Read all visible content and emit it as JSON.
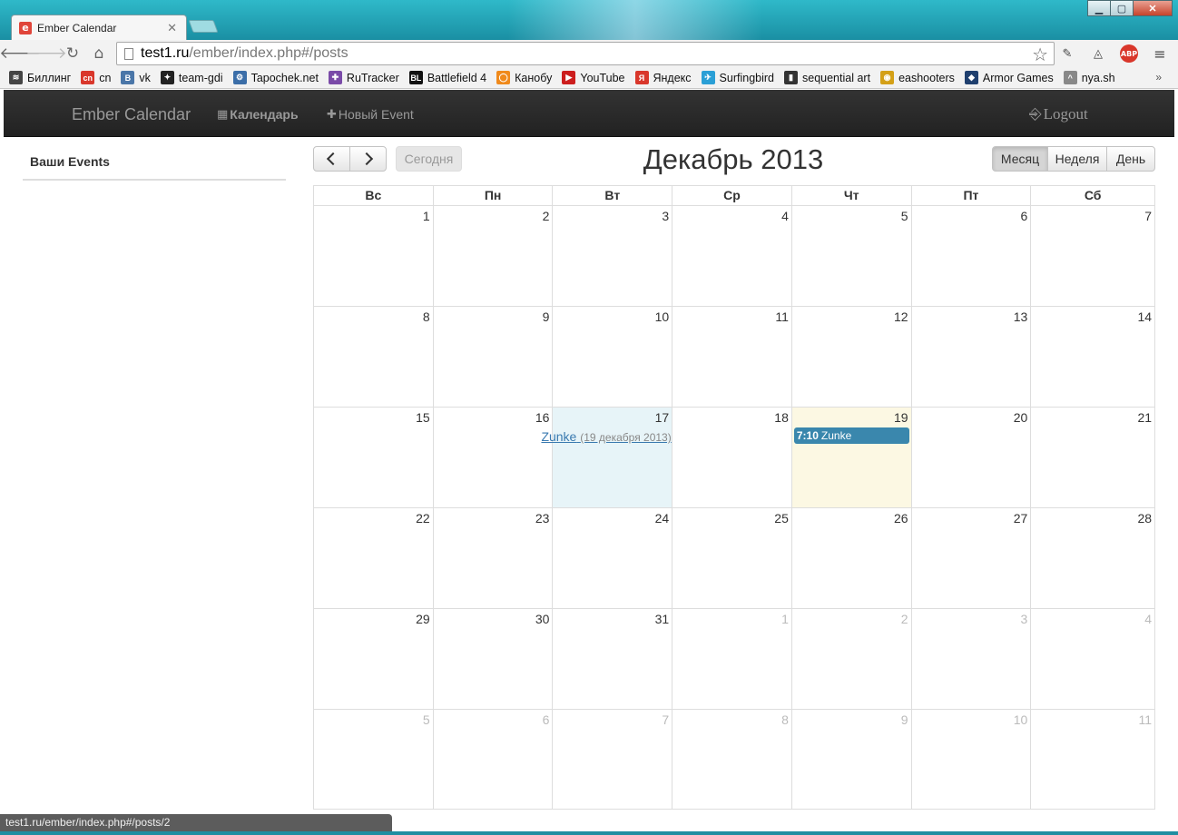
{
  "browser": {
    "tab_title": "Ember Calendar",
    "tab_favicon": "e",
    "url_host": "test1.ru",
    "url_path": "/ember/index.php#/posts",
    "status_url": "test1.ru/ember/index.php#/posts/2",
    "abp_label": "ABP",
    "bookmarks": [
      {
        "label": "Биллинг",
        "icon": "billing-icon",
        "color": "#444444",
        "glyph": "≋"
      },
      {
        "label": "cn",
        "icon": "cn-icon",
        "color": "#d9372b",
        "glyph": "cn"
      },
      {
        "label": "vk",
        "icon": "vk-icon",
        "color": "#4a76a8",
        "glyph": "В"
      },
      {
        "label": "team-gdi",
        "icon": "team-gdi-icon",
        "color": "#222222",
        "glyph": "✦"
      },
      {
        "label": "Tapochek.net",
        "icon": "tapochek-icon",
        "color": "#3b6ea8",
        "glyph": "⚙"
      },
      {
        "label": "RuTracker",
        "icon": "rutracker-icon",
        "color": "#7a4aa8",
        "glyph": "✚"
      },
      {
        "label": "Battlefield 4",
        "icon": "battlefield-icon",
        "color": "#111111",
        "glyph": "BL"
      },
      {
        "label": "Канобу",
        "icon": "kanobu-icon",
        "color": "#f08a1c",
        "glyph": "◯"
      },
      {
        "label": "YouTube",
        "icon": "youtube-icon",
        "color": "#cc1d1d",
        "glyph": "▶"
      },
      {
        "label": "Яндекс",
        "icon": "yandex-icon",
        "color": "#d9372b",
        "glyph": "Я"
      },
      {
        "label": "Surfingbird",
        "icon": "surfingbird-icon",
        "color": "#2a9fd6",
        "glyph": "✈"
      },
      {
        "label": "sequential art",
        "icon": "sequential-art-icon",
        "color": "#333333",
        "glyph": "▮"
      },
      {
        "label": "eashooters",
        "icon": "eashooters-icon",
        "color": "#d4a017",
        "glyph": "◉"
      },
      {
        "label": "Armor Games",
        "icon": "armor-games-icon",
        "color": "#1f3f6e",
        "glyph": "◆"
      },
      {
        "label": "nya.sh",
        "icon": "nya-icon",
        "color": "#888888",
        "glyph": "^"
      }
    ]
  },
  "app": {
    "brand": "Ember Calendar",
    "nav_calendar": "Календарь",
    "nav_new_event": "Новый Event",
    "logout": "Logout",
    "sidebar_title": "Ваши Events"
  },
  "calendar": {
    "title": "Декабрь 2013",
    "today_label": "Сегодня",
    "view_month": "Месяц",
    "view_week": "Неделя",
    "view_day": "День",
    "active_view": "month",
    "weekdays": [
      "Вс",
      "Пн",
      "Вт",
      "Ср",
      "Чт",
      "Пт",
      "Сб"
    ],
    "weeks": [
      [
        {
          "d": "1"
        },
        {
          "d": "2"
        },
        {
          "d": "3"
        },
        {
          "d": "4"
        },
        {
          "d": "5"
        },
        {
          "d": "6"
        },
        {
          "d": "7"
        }
      ],
      [
        {
          "d": "8"
        },
        {
          "d": "9"
        },
        {
          "d": "10"
        },
        {
          "d": "11"
        },
        {
          "d": "12"
        },
        {
          "d": "13"
        },
        {
          "d": "14"
        }
      ],
      [
        {
          "d": "15"
        },
        {
          "d": "16"
        },
        {
          "d": "17",
          "state": "selected"
        },
        {
          "d": "18"
        },
        {
          "d": "19",
          "state": "today"
        },
        {
          "d": "20"
        },
        {
          "d": "21"
        }
      ],
      [
        {
          "d": "22"
        },
        {
          "d": "23"
        },
        {
          "d": "24"
        },
        {
          "d": "25"
        },
        {
          "d": "26"
        },
        {
          "d": "27"
        },
        {
          "d": "28"
        }
      ],
      [
        {
          "d": "29"
        },
        {
          "d": "30"
        },
        {
          "d": "31"
        },
        {
          "d": "1",
          "other": true
        },
        {
          "d": "2",
          "other": true
        },
        {
          "d": "3",
          "other": true
        },
        {
          "d": "4",
          "other": true
        }
      ],
      [
        {
          "d": "5",
          "other": true
        },
        {
          "d": "6",
          "other": true
        },
        {
          "d": "7",
          "other": true
        },
        {
          "d": "8",
          "other": true
        },
        {
          "d": "9",
          "other": true
        },
        {
          "d": "10",
          "other": true
        },
        {
          "d": "11",
          "other": true
        }
      ]
    ],
    "events": [
      {
        "week": 2,
        "day": 2,
        "kind": "link",
        "title": "Zunke",
        "date": "(19 декабря 2013)"
      },
      {
        "week": 2,
        "day": 4,
        "kind": "bar",
        "time": "7:10",
        "title": "Zunke",
        "color": "#3a87ad"
      }
    ],
    "colors": {
      "selected_bg": "#e7f4f8",
      "today_bg": "#fcf8e3",
      "event_bg": "#3a87ad"
    }
  }
}
